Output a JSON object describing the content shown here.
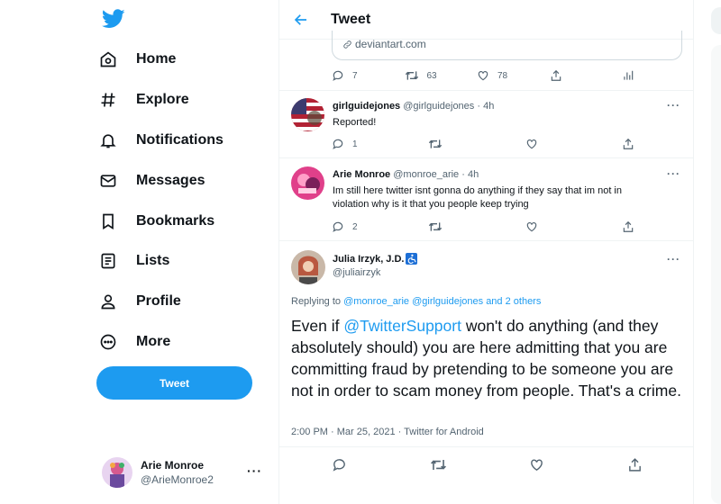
{
  "nav": {
    "items": [
      {
        "label": "Home",
        "icon": "home-icon"
      },
      {
        "label": "Explore",
        "icon": "hashtag-icon"
      },
      {
        "label": "Notifications",
        "icon": "bell-icon"
      },
      {
        "label": "Messages",
        "icon": "envelope-icon"
      },
      {
        "label": "Bookmarks",
        "icon": "bookmark-icon"
      },
      {
        "label": "Lists",
        "icon": "list-icon"
      },
      {
        "label": "Profile",
        "icon": "person-icon"
      },
      {
        "label": "More",
        "icon": "more-circle-icon"
      }
    ],
    "tweet_button": "Tweet",
    "account": {
      "name": "Arie Monroe",
      "handle": "@ArieMonroe2",
      "more": "···"
    }
  },
  "header": {
    "title": "Tweet"
  },
  "prev_tweet": {
    "link_domain": "deviantart.com",
    "replies": "7",
    "retweets": "63",
    "likes": "78"
  },
  "replies": [
    {
      "name": "girlguidejones",
      "handle": "@girlguidejones · 4h",
      "text": "Reported!",
      "reply_count": "1"
    },
    {
      "name": "Arie Monroe",
      "handle": "@monroe_arie · 4h",
      "text": "Im still here twitter isnt gonna do anything if they say that im not in violation why is it that you people keep trying",
      "reply_count": "2"
    }
  ],
  "focus": {
    "name": "Julia Irzyk, J.D.",
    "handle": "@juliairzyk",
    "replying_prefix": "Replying to",
    "replying_to": "@monroe_arie @girlguidejones and 2 others",
    "mention": "@TwitterSupport",
    "text_before": "Even if ",
    "text_after": " won't do anything (and they absolutely should) you are here admitting that you are committing fraud by pretending to be someone you are not in order to scam money from people. That's a crime.",
    "meta": "2:00 PM · Mar 25, 2021 · Twitter for Android"
  },
  "colors": {
    "accent": "#1d9bf0",
    "text": "#0f1419",
    "muted": "#536471"
  }
}
